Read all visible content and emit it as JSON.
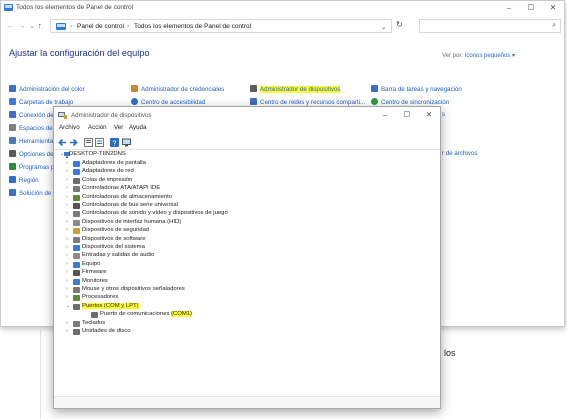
{
  "colors": {
    "accent": "#1c5fc7",
    "heading": "#1e3287",
    "highlight": "#ffff2e"
  },
  "control_panel": {
    "title": "Todos los elementos de Panel de control",
    "breadcrumb": {
      "root_arrow": "›",
      "item1": "Panel de control",
      "sep": "›",
      "item2": "Todos los elementos de Panel de control"
    },
    "search_placeholder": "",
    "heading": "Ajustar la configuración del equipo",
    "view_by_label": "Ver por:",
    "view_by_value": "Iconos pequeños ▾",
    "items": [
      {
        "label": "Administración del color",
        "icon": "color-management-icon",
        "color": "#3a6fc4"
      },
      {
        "label": "Carpetas de trabajo",
        "icon": "work-folders-icon",
        "color": "#3b7bd6"
      },
      {
        "label": "Conexión de",
        "icon": "remote-connection-icon",
        "color": "#3a6fc4"
      },
      {
        "label": "Espacios de",
        "icon": "storage-spaces-icon",
        "color": "#7e7e7e"
      },
      {
        "label": "Herramienta",
        "icon": "admin-tools-icon",
        "color": "#4a78b8"
      },
      {
        "label": "Opciones de",
        "icon": "options-icon",
        "color": "#5a5a5a"
      },
      {
        "label": "Programas p",
        "icon": "default-programs-icon",
        "color": "#2f8a36"
      },
      {
        "label": "Región",
        "icon": "region-icon",
        "color": "#2e6fc4"
      },
      {
        "label": "Solución de",
        "icon": "troubleshooting-icon",
        "color": "#3a6fc4"
      },
      {
        "label": "Administrador de credenciales",
        "icon": "credential-manager-icon",
        "color": "#c9872e"
      },
      {
        "label": "Centro de accesibilidad",
        "icon": "accessibility-icon",
        "color": "#2e6fc4"
      },
      {
        "label": "Administrador de dispositivos",
        "icon": "device-manager-icon",
        "color": "#5c5c5c"
      },
      {
        "label": "Centro de redes y recursos comparti...",
        "icon": "network-center-icon",
        "color": "#3a6fc4"
      },
      {
        "label": "Barra de tareas y navegación",
        "icon": "taskbar-icon",
        "color": "#3a6fc4"
      },
      {
        "label": "Centro de sincronización",
        "icon": "sync-center-icon",
        "color": "#2f9a3a"
      },
      {
        "label": "s",
        "icon": "",
        "color": ""
      },
      {
        "label": "r de archivos",
        "icon": "",
        "color": ""
      }
    ]
  },
  "background_text": "los",
  "device_manager": {
    "title": "Administrador de dispositivos",
    "menu": [
      "Archivo",
      "Acción",
      "Ver",
      "Ayuda"
    ],
    "toolbar_icons": [
      "back-icon",
      "forward-icon",
      "properties-icon",
      "list-icon",
      "help-icon",
      "monitor-icon"
    ],
    "root": "DESKTOP-TIIN2DNS",
    "nodes": [
      {
        "label": "Adaptadores de pantalla",
        "icon": "display-adapter-icon",
        "color": "#3a7bd5",
        "expanded": false
      },
      {
        "label": "Adaptadores de red",
        "icon": "network-adapter-icon",
        "color": "#3a7bd5",
        "expanded": false
      },
      {
        "label": "Colas de impresión",
        "icon": "print-queue-icon",
        "color": "#6d6d6d",
        "expanded": false
      },
      {
        "label": "Controladoras ATA/ATAPI IDE",
        "icon": "ide-controller-icon",
        "color": "#7a7a7a",
        "expanded": false
      },
      {
        "label": "Controladoras de almacenamiento",
        "icon": "storage-controller-icon",
        "color": "#5e8a3a",
        "expanded": false
      },
      {
        "label": "Controladoras de bus serie universal",
        "icon": "usb-controller-icon",
        "color": "#555555",
        "expanded": false
      },
      {
        "label": "Controladoras de sonido y vídeo y dispositivos de juego",
        "icon": "sound-icon",
        "color": "#7a7a7a",
        "expanded": false
      },
      {
        "label": "Dispositivos de interfaz humana (HID)",
        "icon": "hid-icon",
        "color": "#8a8a8a",
        "expanded": false
      },
      {
        "label": "Dispositivos de seguridad",
        "icon": "security-device-icon",
        "color": "#c9a23a",
        "expanded": false
      },
      {
        "label": "Dispositivos de software",
        "icon": "software-device-icon",
        "color": "#7a7a7a",
        "expanded": false
      },
      {
        "label": "Dispositivos del sistema",
        "icon": "system-device-icon",
        "color": "#3a7bd5",
        "expanded": false
      },
      {
        "label": "Entradas y salidas de audio",
        "icon": "audio-io-icon",
        "color": "#8a8a8a",
        "expanded": false
      },
      {
        "label": "Equipo",
        "icon": "computer-icon",
        "color": "#3a7bd5",
        "expanded": false
      },
      {
        "label": "Firmware",
        "icon": "firmware-icon",
        "color": "#555555",
        "expanded": false
      },
      {
        "label": "Monitores",
        "icon": "monitor-icon",
        "color": "#3a7bd5",
        "expanded": false
      },
      {
        "label": "Mouse y otros dispositivos señaladores",
        "icon": "mouse-icon",
        "color": "#7a7a7a",
        "expanded": false
      },
      {
        "label": "Procesadores",
        "icon": "processor-icon",
        "color": "#5e8a3a",
        "expanded": false
      },
      {
        "label": "Puertos (COM y LPT)",
        "icon": "ports-icon",
        "color": "#6d6d6d",
        "expanded": true,
        "highlighted": true
      },
      {
        "label": "Puerto de comunicaciones (COM1)",
        "icon": "com-port-icon",
        "color": "#6d6d6d",
        "child": true,
        "highlighted_suffix": "(COM1)"
      },
      {
        "label": "Teclados",
        "icon": "keyboard-icon",
        "color": "#7a7a7a",
        "expanded": false
      },
      {
        "label": "Unidades de disco",
        "icon": "disk-drive-icon",
        "color": "#6d6d6d",
        "expanded": false
      }
    ]
  }
}
